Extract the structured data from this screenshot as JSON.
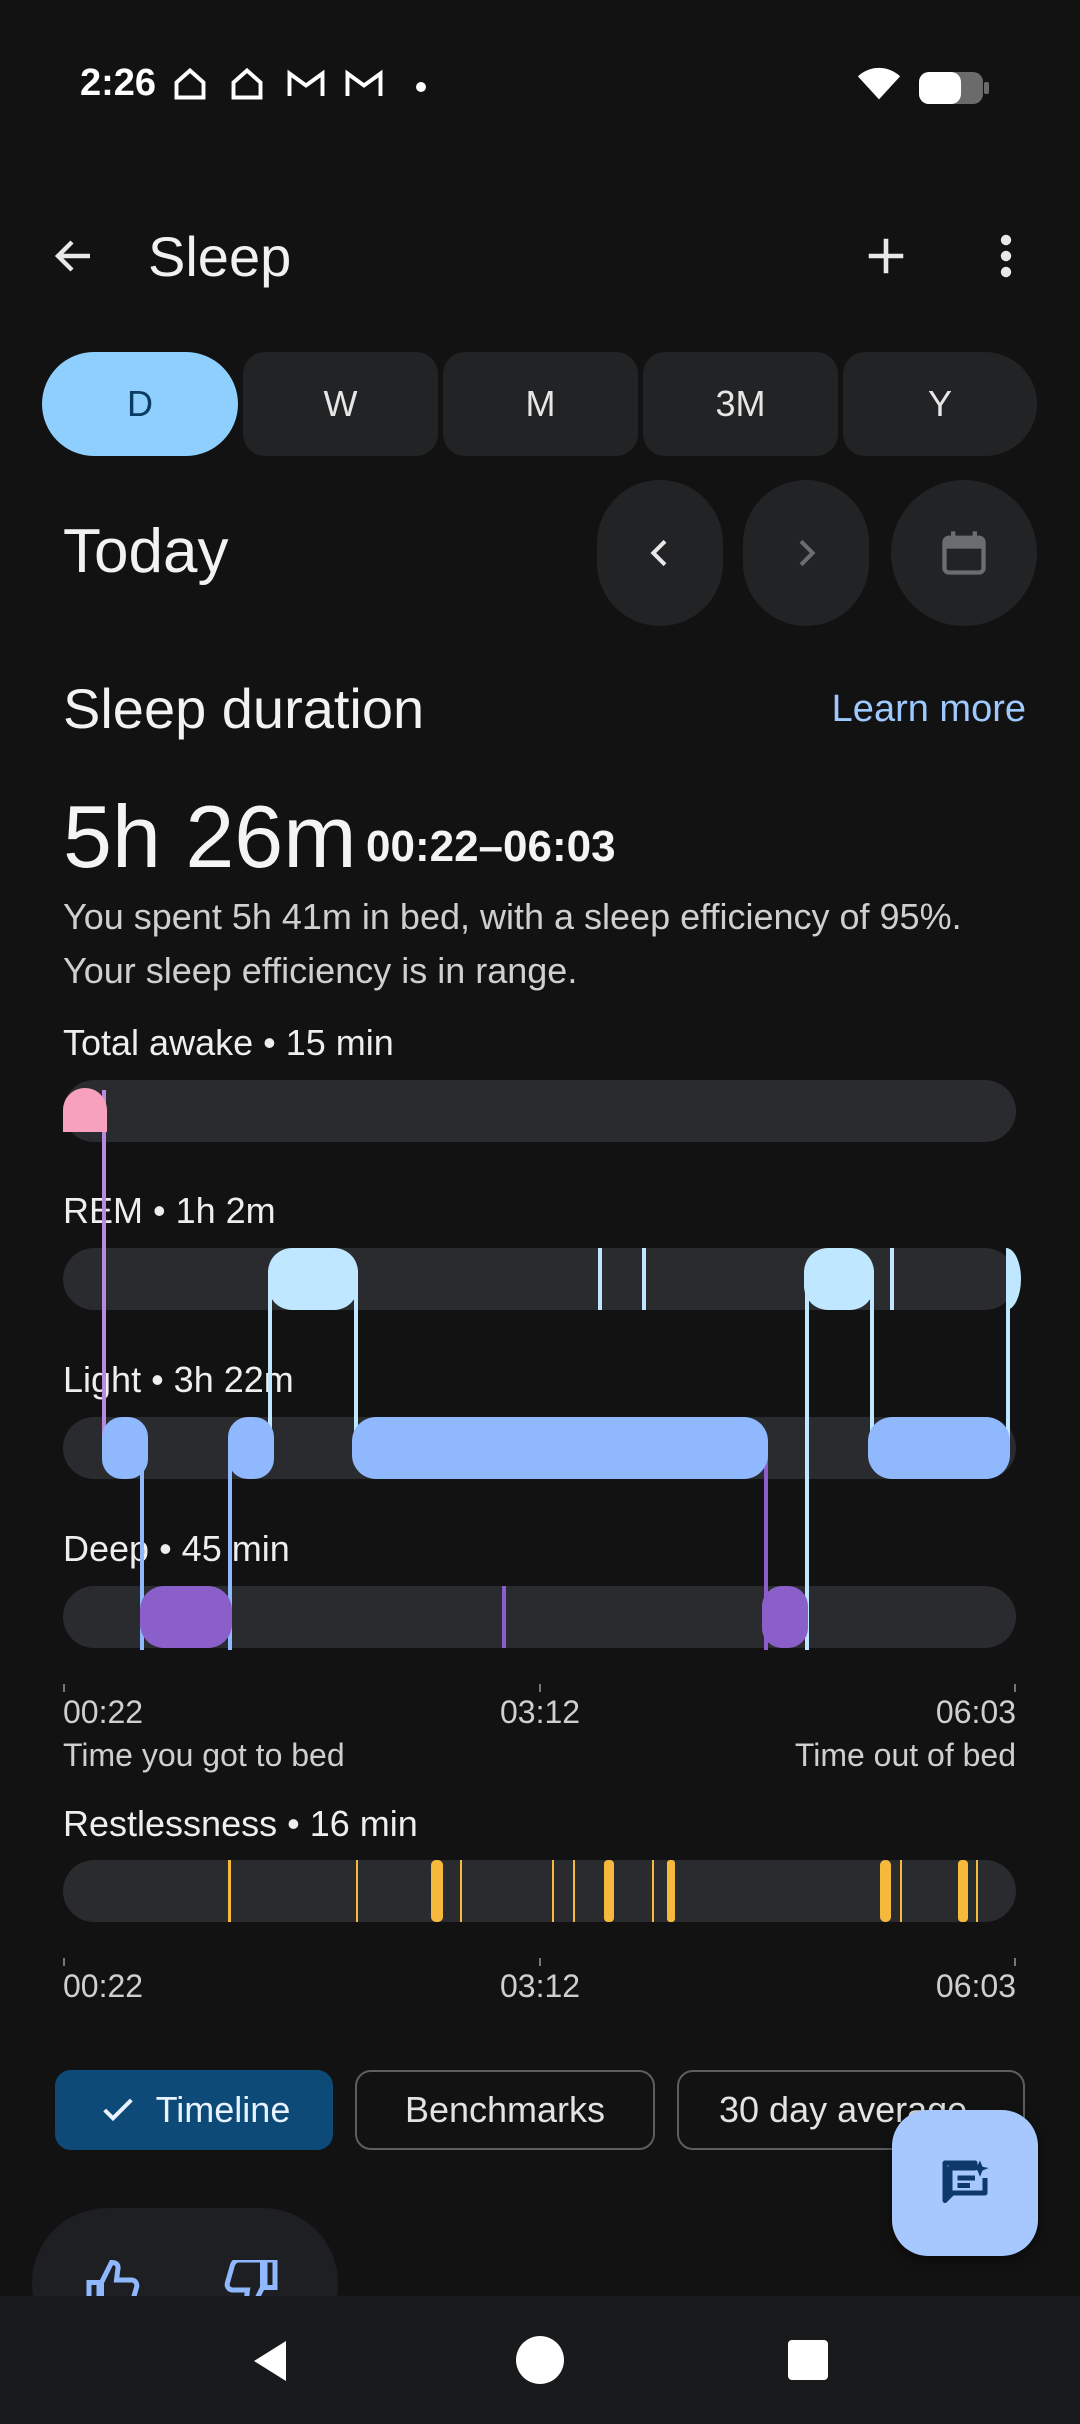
{
  "status_bar": {
    "time": "2:26",
    "icons": [
      "home-icon",
      "home-icon",
      "gmail-icon",
      "gmail-icon",
      "dot-icon"
    ],
    "right_icons": [
      "wifi-icon",
      "battery-icon"
    ]
  },
  "app_bar": {
    "title": "Sleep",
    "icons": [
      "back-arrow-icon",
      "add-icon",
      "more-vert-icon"
    ]
  },
  "periods": [
    {
      "label": "D",
      "active": true
    },
    {
      "label": "W"
    },
    {
      "label": "M"
    },
    {
      "label": "3M"
    },
    {
      "label": "Y"
    }
  ],
  "date_nav": {
    "label": "Today",
    "icons": [
      "chevron-left-icon",
      "chevron-right-icon",
      "calendar-icon"
    ]
  },
  "section": {
    "title": "Sleep duration",
    "link": "Learn more",
    "duration": "5h 26m",
    "range": "00:22–06:03",
    "summary": "You spent 5h 41m in bed, with a sleep efficiency of 95%. Your sleep efficiency is in range."
  },
  "stages": {
    "awake": "Total awake • 15 min",
    "rem": "REM • 1h 2m",
    "light": "Light • 3h 22m",
    "deep": "Deep • 45 min"
  },
  "axis": {
    "start": "00:22",
    "mid": "03:12",
    "end": "06:03",
    "start_caption": "Time you got to bed",
    "end_caption": "Time out of bed"
  },
  "restlessness": {
    "label": "Restlessness • 16 min"
  },
  "chips": [
    {
      "label": "Timeline",
      "selected": true
    },
    {
      "label": "Benchmarks"
    },
    {
      "label": "30 day average"
    }
  ],
  "colors": {
    "awake": "#f7a1bf",
    "rem": "#bfe7ff",
    "light": "#8fb8ff",
    "deep": "#8b5fc9",
    "restless": "#f6b93b",
    "accent": "#8ecfff"
  }
}
